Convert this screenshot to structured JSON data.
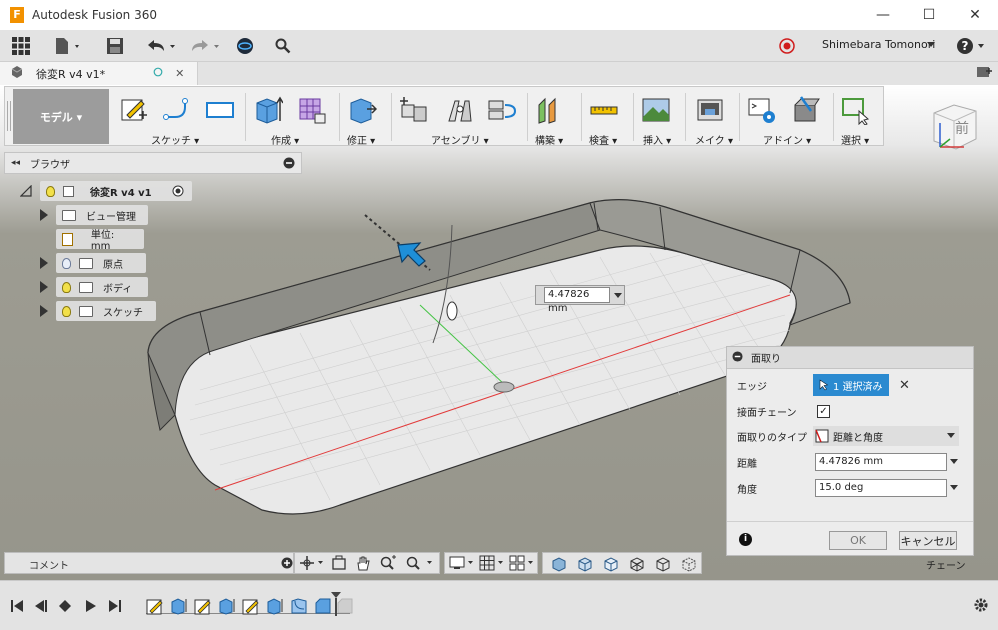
{
  "window": {
    "app_title": "Autodesk Fusion 360",
    "logo_letter": "F",
    "minimize_glyph": "—",
    "maximize_glyph": "☐",
    "close_glyph": "✕"
  },
  "appbar": {
    "user_name": "Shimebara Tomonori",
    "help_label": "?"
  },
  "document_tab": {
    "name": "徐変R v4 v1*"
  },
  "toolbar": {
    "mode_label": "モデル ▾",
    "groups": [
      "スケッチ ▾",
      "作成 ▾",
      "修正 ▾",
      "アセンブリ ▾",
      "構築 ▾",
      "検査 ▾",
      "挿入 ▾",
      "メイク ▾",
      "アドイン ▾",
      "選択 ▾"
    ]
  },
  "viewcube": {
    "face_label": "前",
    "axis_colors": {
      "x": "#d13b3b",
      "y": "#2fa02f",
      "z": "#2f5fd0"
    }
  },
  "browser": {
    "title": "ブラウザ",
    "root": "徐変R v4 v1",
    "items": [
      {
        "label": "ビュー管理"
      },
      {
        "label": "単位: mm"
      },
      {
        "label": "原点"
      },
      {
        "label": "ボディ"
      },
      {
        "label": "スケッチ"
      }
    ]
  },
  "dimension_input": {
    "value": "4.47826 mm"
  },
  "chamfer_dialog": {
    "title": "面取り",
    "edge_label": "エッジ",
    "edge_selection": "1 選択済み",
    "tangent_chain_label": "接面チェーン",
    "tangent_chain_checked": true,
    "chamfer_type_label": "面取りのタイプ",
    "chamfer_type_value": "距離と角度",
    "distance_label": "距離",
    "distance_value": "4.47826 mm",
    "angle_label": "角度",
    "angle_value": "15.0 deg",
    "ok_label": "OK",
    "cancel_label": "キャンセル",
    "info_glyph": "i"
  },
  "comment_bar": {
    "label": "コメント"
  },
  "viewport_hint": {
    "label": "チェーン"
  },
  "colors": {
    "accent_blue": "#2b8ad0",
    "record_red": "#d01c1c",
    "floor_red_axis": "#e23b3b",
    "floor_green_axis": "#45c445"
  }
}
